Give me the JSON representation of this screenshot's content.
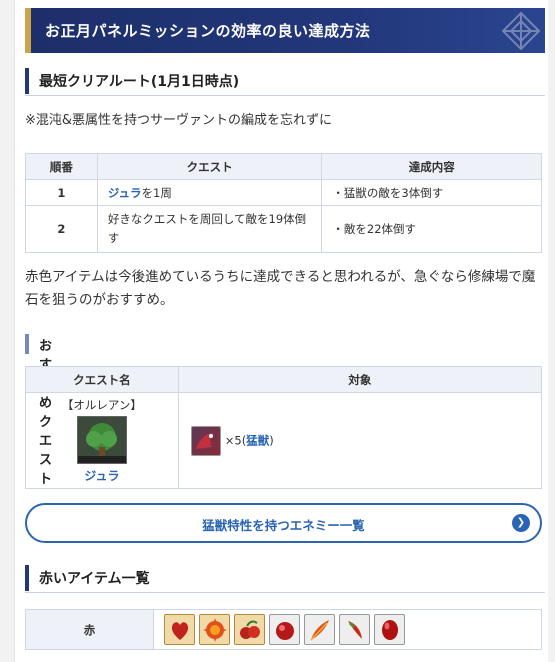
{
  "header": {
    "title": "お正月パネルミッションの効率の良い達成方法"
  },
  "section_route": {
    "title": "最短クリアルート(1月1日時点)",
    "note": "※混沌&悪属性を持つサーヴァントの編成を忘れずに",
    "columns": [
      "順番",
      "クエスト",
      "達成内容"
    ],
    "rows": [
      {
        "order": "1",
        "quest_link": "ジュラ",
        "quest_suffix": "を1周",
        "content": "・猛獣の敵を3体倒す"
      },
      {
        "order": "2",
        "quest_link": "",
        "quest_suffix": "好きなクエストを周回して敵を19体倒す",
        "content": "・敵を22体倒す"
      }
    ],
    "paragraph": "赤色アイテムは今後進めているうちに達成できると思われるが、急ぐなら修練場で魔石を狙うのがおすすめ。"
  },
  "section_quest": {
    "title": "おすすめクエスト",
    "columns": [
      "クエスト名",
      "対象"
    ],
    "row": {
      "area": "【オルレアン】",
      "quest": "ジュラ",
      "target_count": "×5(",
      "target_trait": "猛獣",
      "target_close": ")"
    }
  },
  "button": {
    "label": "猛獣特性を持つエネミー一覧"
  },
  "section_items": {
    "title": "赤いアイテム一覧",
    "row_label": "赤",
    "item_icons": [
      "red-heart-icon",
      "red-flame-icon",
      "red-fruit-icon",
      "red-gem-icon",
      "red-feather-icon",
      "red-fang-icon",
      "red-stone-icon"
    ]
  },
  "colors": {
    "header_bg": "#22367a",
    "accent_gold": "#caa448",
    "link": "#2a64b5",
    "table_header": "#eef1f7"
  }
}
